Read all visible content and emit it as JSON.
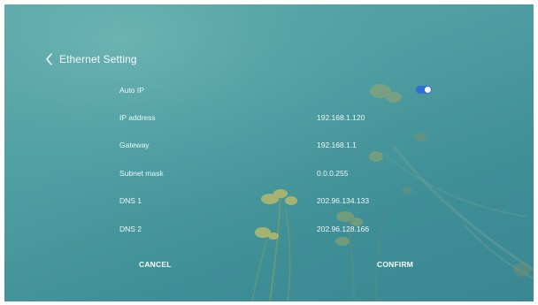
{
  "header": {
    "title": "Ethernet Setting",
    "back_icon": "chevron-left-icon"
  },
  "settings": {
    "auto_ip": {
      "label": "Auto IP",
      "enabled": true
    },
    "ip_address": {
      "label": "IP address",
      "value": "192.168.1.120"
    },
    "gateway": {
      "label": "Gateway",
      "value": "192.168.1.1"
    },
    "subnet_mask": {
      "label": "Subnet mask",
      "value": "0.0.0.255"
    },
    "dns1": {
      "label": "DNS 1",
      "value": "202.96.134.133"
    },
    "dns2": {
      "label": "DNS 2",
      "value": "202.96.128.166"
    }
  },
  "actions": {
    "cancel_label": "CANCEL",
    "confirm_label": "CONFIRM"
  },
  "colors": {
    "background": "#4f9fa3",
    "toggle_on": "#2f6fd6",
    "text": "#eef7f7"
  }
}
